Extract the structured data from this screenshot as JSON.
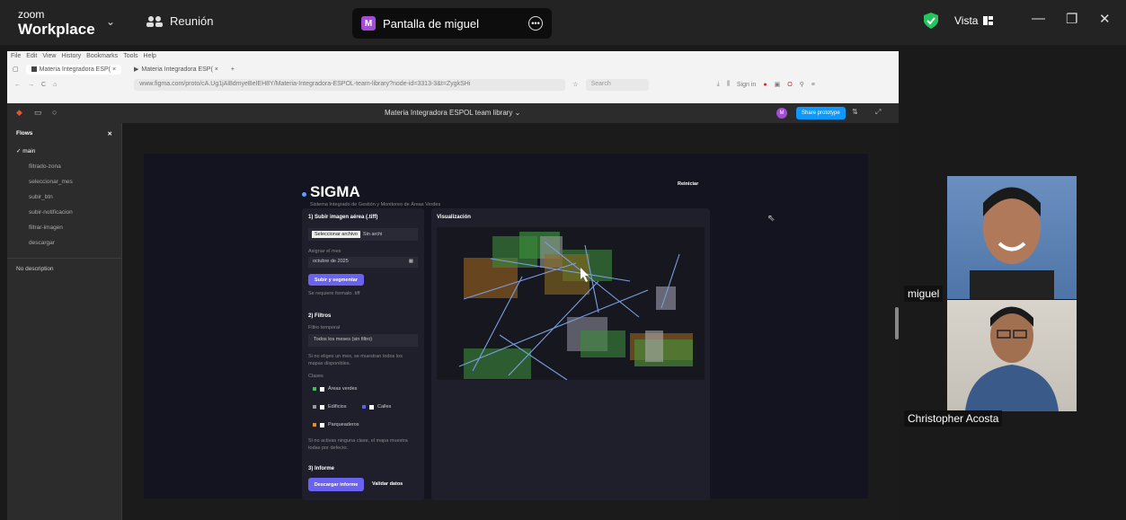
{
  "zoom": {
    "logo_small": "zoom",
    "logo_big": "Workplace",
    "meeting_label": "Reunión",
    "share_avatar_letter": "M",
    "share_tab_label": "Pantalla de miguel",
    "view_label": "Vista"
  },
  "browser": {
    "menu": [
      "File",
      "Edit",
      "View",
      "History",
      "Bookmarks",
      "Tools",
      "Help"
    ],
    "tabs": [
      {
        "label": "Materia Integradora ESP( ×"
      },
      {
        "label": "Materia Integradora ESP( ×"
      }
    ],
    "url": "www.figma.com/proto/cA.Ug1jAl8dmyeBeIEH8Y/Materia-Integradora-ESPOL-team-library?node-id=3313-3&t=ZygkSHi",
    "search_placeholder": "Search",
    "sign_in": "Sign in"
  },
  "figma": {
    "title": "Materia Integradora ESPOL team library",
    "avatar_letter": "M",
    "share_prototype": "Share prototype",
    "flows_header": "Flows",
    "flows": [
      "main",
      "filtrado-zona",
      "seleccionar_mes",
      "subir_btn",
      "subir-notificacion",
      "filtrar-imagen",
      "descargar"
    ],
    "no_description": "No description"
  },
  "app": {
    "title": "SIGMA",
    "subtitle": "Sistema Integrado de Gestión y Monitoreo de Áreas Verdes",
    "reset": "Reiniciar",
    "section1_title": "1) Subir imagen aérea (.tiff)",
    "choose_file": "Seleccionar archivo",
    "no_file": "Sin archi",
    "assign_month": "Asignar el mes",
    "month_value": "octubre  de  2025",
    "upload_btn": "Subir y segmentar",
    "formats_note": "Se requiere formato .tiff",
    "section2_title": "2) Filtros",
    "temporal_filter": "Filtro temporal",
    "filter_value": "Todos los meses (sin filtro)",
    "filter_note": "Si no eliges un mes, se muestran todos los mapas disponibles.",
    "classes_label": "Clases",
    "classes": [
      {
        "name": "Áreas verdes",
        "color": "#3fbf5a"
      },
      {
        "name": "Edificios",
        "color": "#9a9a9a"
      },
      {
        "name": "Calles",
        "color": "#5b5ff0"
      },
      {
        "name": "Parqueaderos",
        "color": "#f08a1d"
      }
    ],
    "classes_note": "Si no activas ninguna clase, el mapa muestra todas por defecto.",
    "section3_title": "3) Informe",
    "download_btn": "Descargar informe",
    "validate_btn": "Validar datos",
    "vis_title": "Visualización"
  },
  "participants": [
    {
      "name": "miguel"
    },
    {
      "name": "Christopher Acosta"
    }
  ]
}
